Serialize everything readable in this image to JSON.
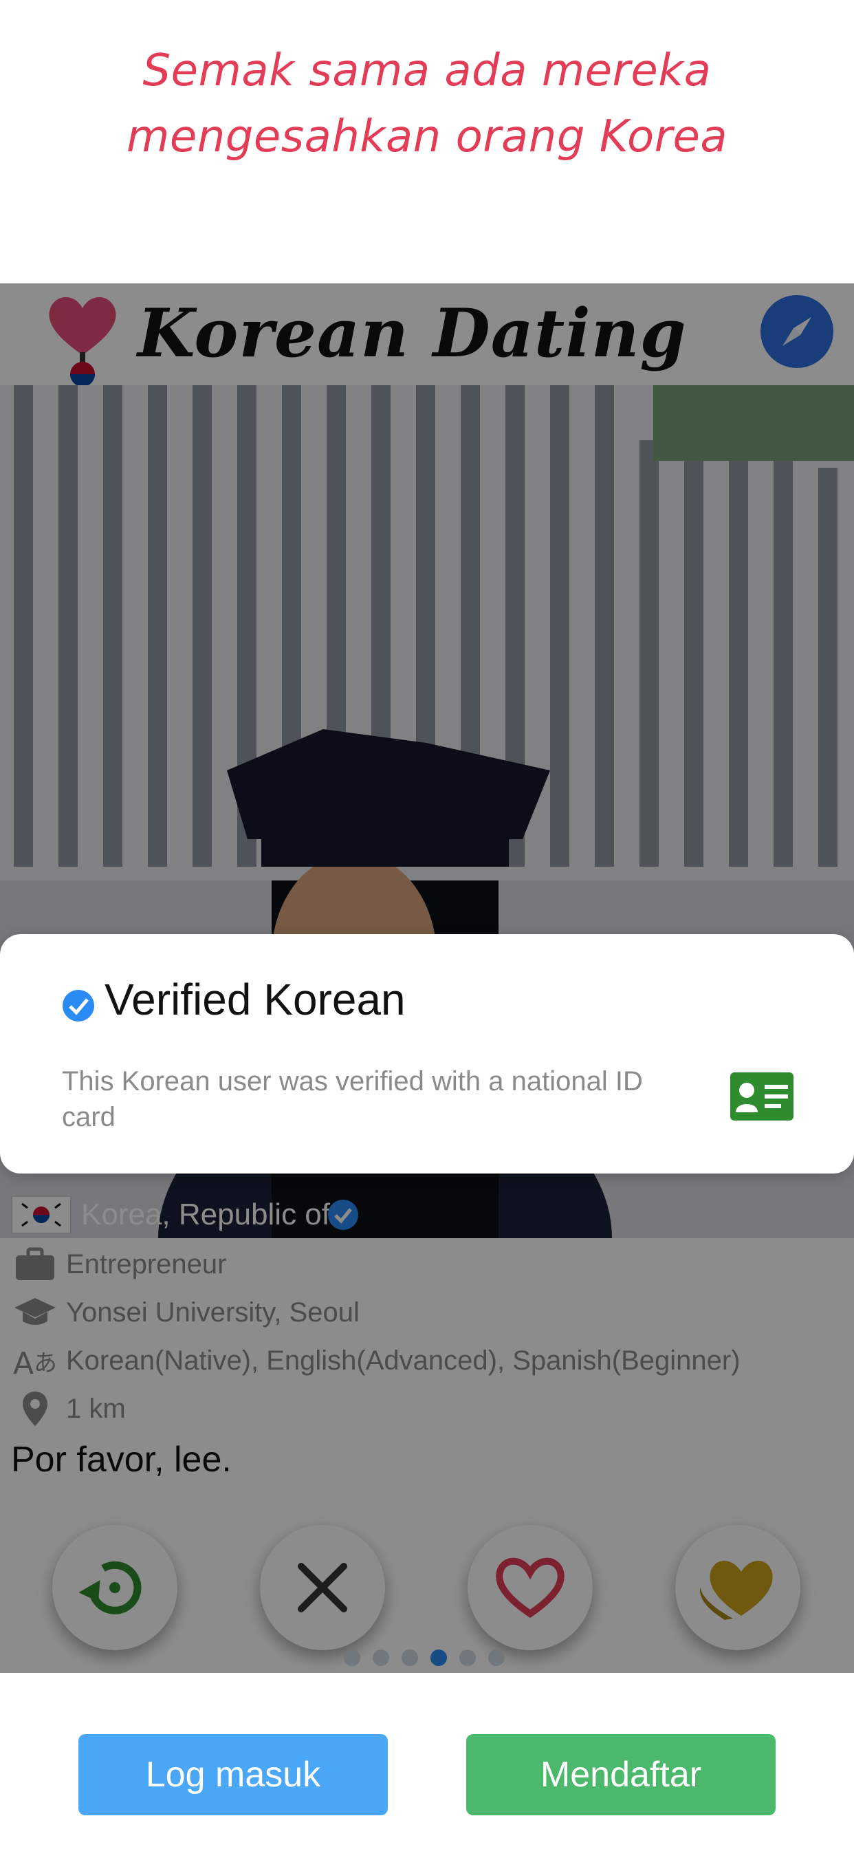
{
  "caption": "Semak sama ada mereka mengesahkan orang Korea",
  "app": {
    "title": "Korean Dating",
    "logo_icon": "heart-logo-icon",
    "compass_icon": "compass-icon",
    "accent": "#2f6fe0"
  },
  "verified_card": {
    "title": "Verified Korean",
    "description": "This Korean user was verified with a national ID card",
    "check_icon": "verified-check-icon",
    "id_icon": "id-card-icon"
  },
  "profile": {
    "country": "Korea, Republic of",
    "occupation": "Entrepreneur",
    "school": "Yonsei University, Seoul",
    "languages": "Korean(Native), English(Advanced), Spanish(Beginner)",
    "distance": "1 km",
    "bio": "Por favor, lee."
  },
  "actions": [
    {
      "name": "rewind-button",
      "icon": "rewind-icon",
      "color": "#2e8b2e"
    },
    {
      "name": "nope-button",
      "icon": "close-icon",
      "color": "#333333"
    },
    {
      "name": "like-button",
      "icon": "heart-icon",
      "color": "#e23c57"
    },
    {
      "name": "super-like-button",
      "icon": "gold-heart-icon",
      "color": "#c8a21c"
    }
  ],
  "pagination": {
    "count": 6,
    "active_index": 3
  },
  "buttons": {
    "login": "Log masuk",
    "signup": "Mendaftar",
    "login_color": "#4aa6f7",
    "signup_color": "#4cb86c"
  }
}
